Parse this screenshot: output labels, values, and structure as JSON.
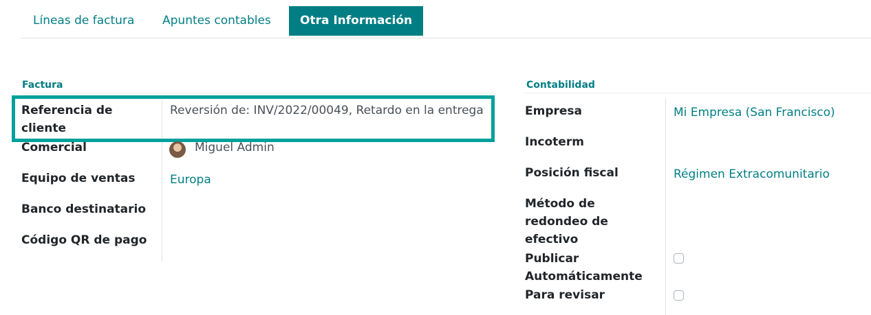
{
  "tabs": [
    {
      "label": "Líneas de factura",
      "active": false
    },
    {
      "label": "Apuntes contables",
      "active": false
    },
    {
      "label": "Otra Información",
      "active": true
    }
  ],
  "factura": {
    "title": "Factura",
    "customer_reference_label_line1": "Referencia de",
    "customer_reference_label_line2": "cliente",
    "customer_reference_value": "Reversión de: INV/2022/00049, Retardo en la entrega",
    "salesperson_label": "Comercial",
    "salesperson_value": "Miguel Admin",
    "sales_team_label": "Equipo de ventas",
    "sales_team_value": "Europa",
    "recipient_bank_label": "Banco destinatario",
    "qr_label": "Código QR de pago"
  },
  "contabilidad": {
    "title": "Contabilidad",
    "company_label": "Empresa",
    "company_value": "Mi Empresa (San Francisco)",
    "incoterm_label": "Incoterm",
    "fiscal_position_label": "Posición fiscal",
    "fiscal_position_value": "Régimen Extracomunitario",
    "rounding_label_line1": "Método de",
    "rounding_label_line2": "redondeo de",
    "rounding_label_line3": "efectivo",
    "auto_post_label_line1": "Publicar",
    "auto_post_label_line2": "Automáticamente",
    "auto_post_checked": false,
    "to_check_label": "Para revisar",
    "to_check_checked": false
  },
  "colors": {
    "accent": "#017e84",
    "highlight": "#00a09d"
  }
}
